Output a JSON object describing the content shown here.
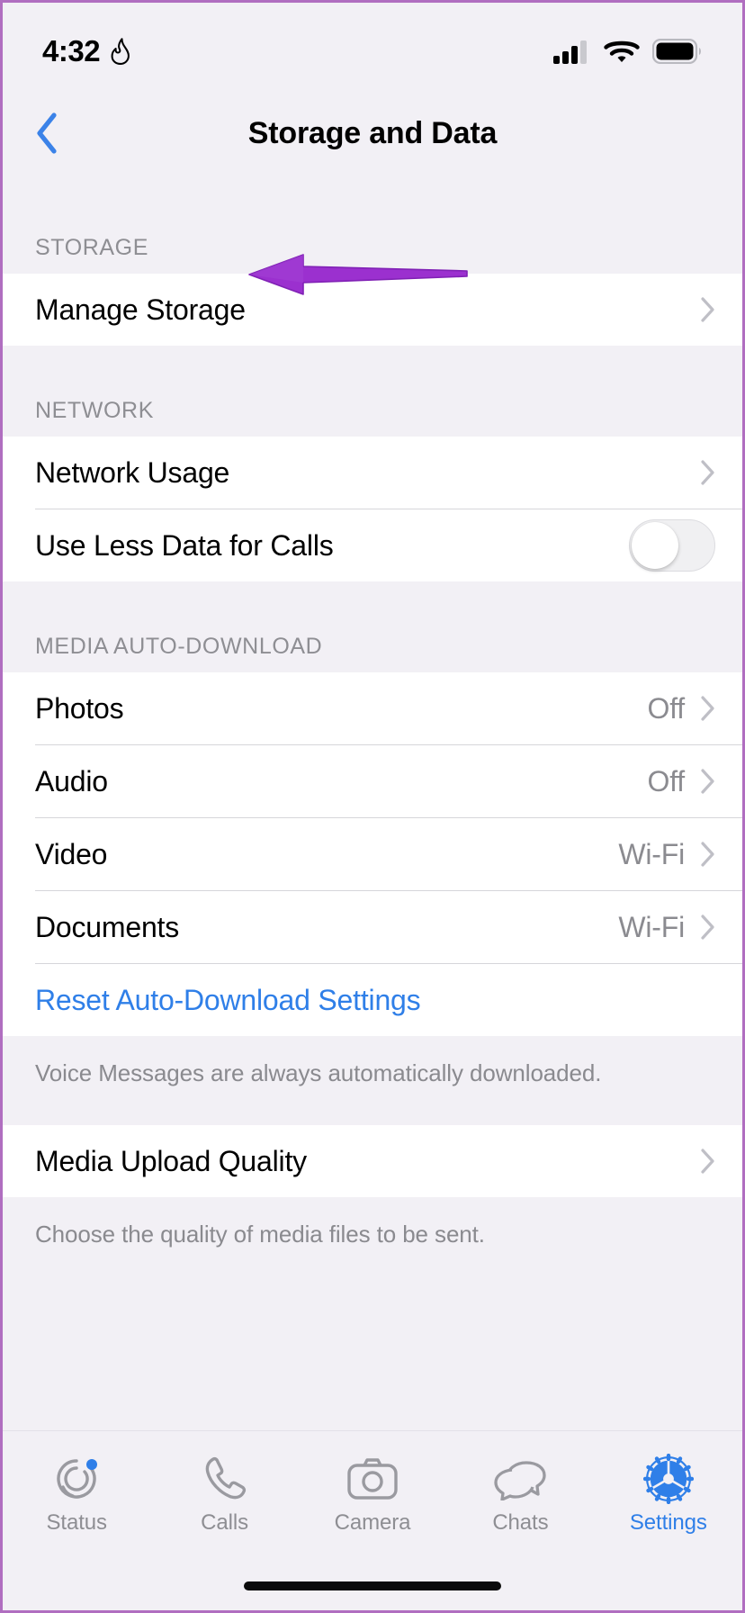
{
  "status_bar": {
    "time": "4:32",
    "flame_icon": "flame-icon",
    "cellular_icon": "cellular-signal-icon",
    "wifi_icon": "wifi-icon",
    "battery_icon": "battery-full-icon"
  },
  "nav": {
    "back_icon": "chevron-left-icon",
    "title": "Storage and Data"
  },
  "sections": {
    "storage": {
      "header": "STORAGE",
      "rows": [
        {
          "label": "Manage Storage",
          "value": "",
          "chevron": true
        }
      ]
    },
    "network": {
      "header": "NETWORK",
      "rows": [
        {
          "label": "Network Usage",
          "value": "",
          "chevron": true
        },
        {
          "label": "Use Less Data for Calls",
          "toggle": "off"
        }
      ]
    },
    "media_auto_download": {
      "header": "MEDIA AUTO-DOWNLOAD",
      "rows": [
        {
          "label": "Photos",
          "value": "Off",
          "chevron": true
        },
        {
          "label": "Audio",
          "value": "Off",
          "chevron": true
        },
        {
          "label": "Video",
          "value": "Wi-Fi",
          "chevron": true
        },
        {
          "label": "Documents",
          "value": "Wi-Fi",
          "chevron": true
        }
      ],
      "reset_label": "Reset Auto-Download Settings",
      "footnote": "Voice Messages are always automatically downloaded."
    },
    "upload": {
      "rows": [
        {
          "label": "Media Upload Quality",
          "value": "",
          "chevron": true
        }
      ],
      "footnote": "Choose the quality of media files to be sent."
    }
  },
  "annotation": {
    "type": "arrow-left",
    "color": "#9b30cf",
    "target": "Manage Storage"
  },
  "tabbar": {
    "tabs": [
      {
        "label": "Status",
        "icon": "status-rings-icon",
        "active": false,
        "badge": true
      },
      {
        "label": "Calls",
        "icon": "phone-icon",
        "active": false,
        "badge": false
      },
      {
        "label": "Camera",
        "icon": "camera-icon",
        "active": false,
        "badge": false
      },
      {
        "label": "Chats",
        "icon": "chat-bubbles-icon",
        "active": false,
        "badge": false
      },
      {
        "label": "Settings",
        "icon": "gear-icon",
        "active": true,
        "badge": false
      }
    ]
  },
  "colors": {
    "accent_blue": "#2f7fe8",
    "annotation_purple": "#9b30cf",
    "page_bg": "#f2f0f5",
    "card_bg": "#ffffff",
    "secondary_text": "#8e8e93"
  }
}
